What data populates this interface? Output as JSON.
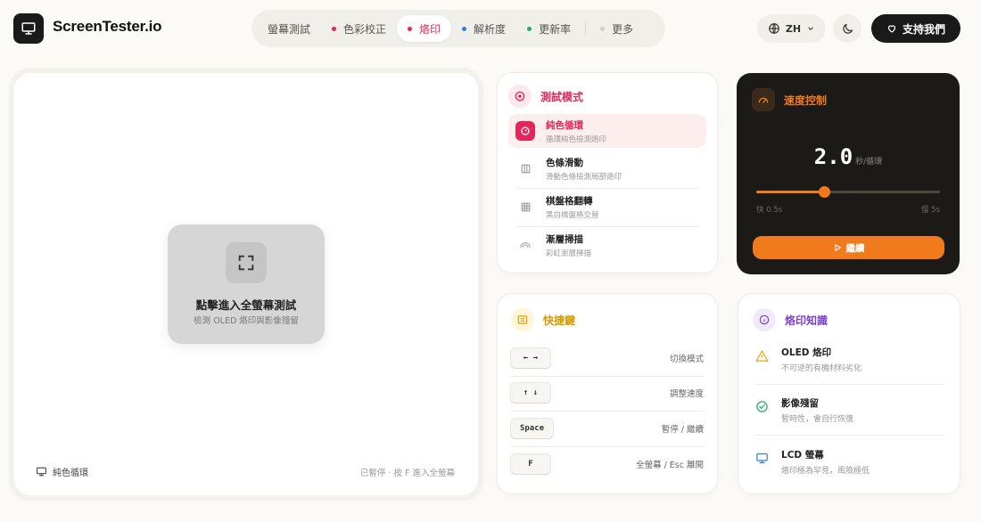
{
  "header": {
    "app_name": "ScreenTester.io",
    "logo_icon": "monitor-icon",
    "nav": [
      {
        "label": "螢幕測試",
        "dot": "",
        "active": false
      },
      {
        "label": "色彩校正",
        "dot": "#e0265a",
        "active": false
      },
      {
        "label": "烙印",
        "dot": "#e0265a",
        "active": true
      },
      {
        "label": "解析度",
        "dot": "#2f7ee0",
        "active": false
      },
      {
        "label": "更新率",
        "dot": "#1fae6b",
        "active": false
      },
      {
        "label": "更多",
        "dot": "#cfcfcf",
        "active": false
      }
    ],
    "language": "ZH",
    "support_label": "支持我們"
  },
  "test_area": {
    "fullscreen_title": "點擊進入全螢幕測試",
    "fullscreen_subtitle": "檢測 OLED 烙印與影像殘留",
    "current_mode": "純色循環",
    "status": "已暫停 · 按 F 進入全螢幕"
  },
  "mode_panel": {
    "title": "測試模式",
    "accent": "#e0265a",
    "items": [
      {
        "name": "純色循環",
        "desc": "循環純色檢測烙印",
        "icon": "circle-dot-icon",
        "active": true
      },
      {
        "name": "色條滑動",
        "desc": "滑動色條檢測局部烙印",
        "icon": "columns-icon",
        "active": false
      },
      {
        "name": "棋盤格翻轉",
        "desc": "黑白棋盤格交替",
        "icon": "grid-icon",
        "active": false
      },
      {
        "name": "漸層掃描",
        "desc": "彩虹漸層掃描",
        "icon": "rainbow-icon",
        "active": false
      }
    ]
  },
  "speed_panel": {
    "title": "速度控制",
    "value": "2.0",
    "unit": "秒/循環",
    "min_label": "快 0.5s",
    "max_label": "慢 5s",
    "level": 0.37,
    "continue_label": "繼續",
    "accent": "#f07a1c"
  },
  "keys_panel": {
    "title": "快捷鍵",
    "rows": [
      {
        "key": "← →",
        "desc": "切換模式"
      },
      {
        "key": "↑ ↓",
        "desc": "調整速度"
      },
      {
        "key": "Space",
        "desc": "暫停 / 繼續"
      },
      {
        "key": "F",
        "desc": "全螢幕 / Esc 離開"
      }
    ]
  },
  "info_panel": {
    "title": "烙印知識",
    "rows": [
      {
        "name": "OLED 烙印",
        "desc": "不可逆的有機材料劣化",
        "icon": "warning-icon",
        "color": "#e8a317"
      },
      {
        "name": "影像殘留",
        "desc": "暫時性，會自行恢復",
        "icon": "check-circle-icon",
        "color": "#1fae6b"
      },
      {
        "name": "LCD 螢幕",
        "desc": "烙印極為罕見，風險極低",
        "icon": "monitor-icon",
        "color": "#2f7ee0"
      }
    ]
  }
}
